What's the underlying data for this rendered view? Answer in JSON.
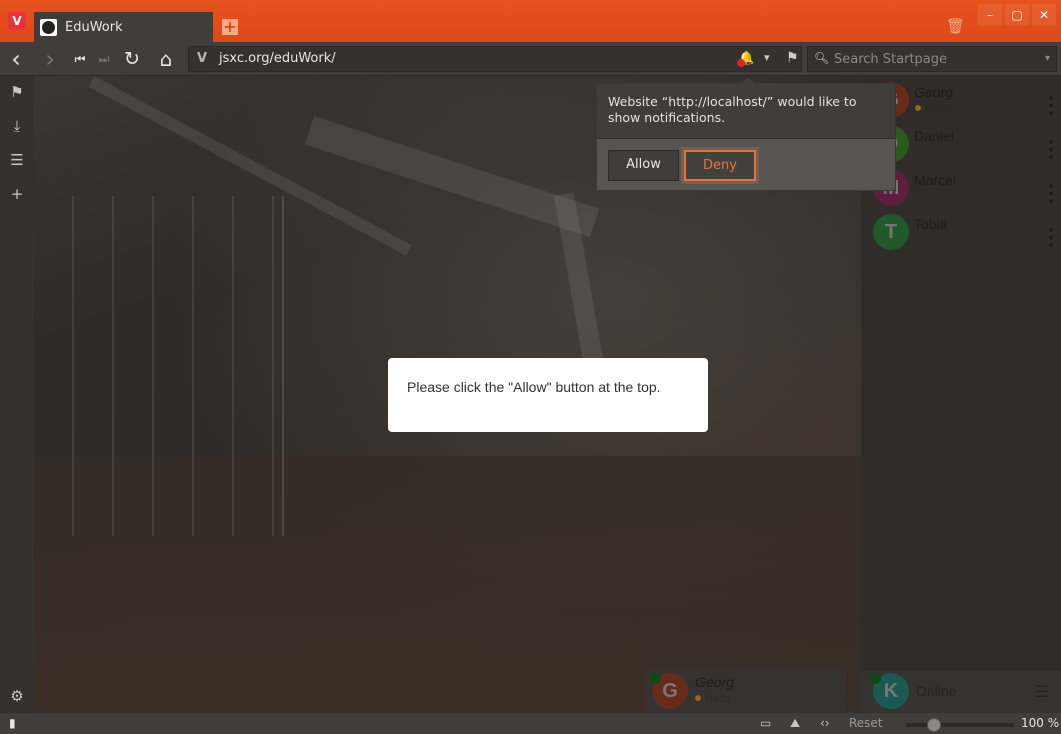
{
  "browser": {
    "tab": {
      "title": "EduWork",
      "favicon": "globe-icon"
    },
    "url": "jsxc.org/eduWork/",
    "search_placeholder": "Search Startpage",
    "icons": {
      "back": "‹",
      "forward": "›",
      "rewind": "⏮",
      "fastforward": "⏭",
      "reload": "↻",
      "home": "⌂",
      "newtab": "+",
      "trash": "🗑",
      "minimize": "–",
      "maximize": "▢",
      "close": "✕",
      "bell": "🔔",
      "dropdown": "▾",
      "bookmark": "⚑",
      "search": "🔍︎"
    },
    "accent": "#dd4a17"
  },
  "sidepanel": {
    "items": [
      {
        "name": "bookmarks",
        "glyph": "⚑"
      },
      {
        "name": "downloads",
        "glyph": "⤓"
      },
      {
        "name": "notes",
        "glyph": "☰"
      },
      {
        "name": "add-panel",
        "glyph": "+"
      }
    ],
    "settings_glyph": "⚙"
  },
  "notification_popup": {
    "message": "Website “http://localhost/” would like to show notifications.",
    "allow_label": "Allow",
    "deny_label": "Deny"
  },
  "page": {
    "dialog_text": "Please click the \"Allow\" button at the top."
  },
  "roster": {
    "contacts": [
      {
        "name": "Georg",
        "initial": "G",
        "status": "Hello",
        "color": "#c0432a",
        "italic": true
      },
      {
        "name": "Daniel",
        "initial": "D",
        "status": "",
        "color": "#3d9a2a",
        "italic": false
      },
      {
        "name": "Marcel",
        "initial": "M",
        "status": "",
        "color": "#b02a6a",
        "italic": false
      },
      {
        "name": "Tobia",
        "initial": "T",
        "status": "",
        "color": "#2a8a3a",
        "italic": false
      }
    ],
    "kebab": "•••"
  },
  "chat_window": {
    "name": "Georg",
    "initial": "G",
    "status": "Hello"
  },
  "self": {
    "initial": "K",
    "presence": "Online",
    "menu_glyph": "☰"
  },
  "statusbar": {
    "panel_toggle": "▮",
    "reset_label": "Reset",
    "zoom_percent": 100,
    "zoom_label": "100 %",
    "tiling": "▭",
    "images": "⛰",
    "code": "‹›"
  }
}
